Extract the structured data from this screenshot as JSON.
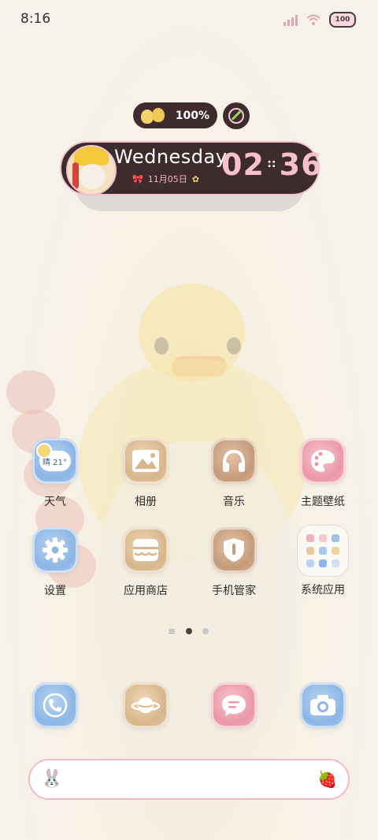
{
  "status": {
    "time": "8:16",
    "battery": "100"
  },
  "widget": {
    "battery_percent": "100%",
    "weekday": "Wednesday",
    "date": "11月05日",
    "time_hours": "02",
    "time_minutes": "36"
  },
  "apps": [
    {
      "label": "天气",
      "icon": "weather-icon",
      "weather_text": "晴 21°"
    },
    {
      "label": "相册",
      "icon": "gallery-icon"
    },
    {
      "label": "音乐",
      "icon": "music-icon"
    },
    {
      "label": "主题壁纸",
      "icon": "theme-palette-icon"
    },
    {
      "label": "设置",
      "icon": "settings-gear-icon"
    },
    {
      "label": "应用商店",
      "icon": "app-store-icon"
    },
    {
      "label": "手机管家",
      "icon": "phone-manager-shield-icon"
    },
    {
      "label": "系统应用",
      "icon": "folder-icon"
    }
  ],
  "dock": [
    {
      "icon": "phone-icon"
    },
    {
      "icon": "browser-planet-icon"
    },
    {
      "icon": "messages-icon"
    },
    {
      "icon": "camera-icon"
    }
  ],
  "colors": {
    "widget_dark": "#3d2b2d",
    "accent_pink": "#f6c0cf",
    "search_border": "#f2b9c8"
  }
}
